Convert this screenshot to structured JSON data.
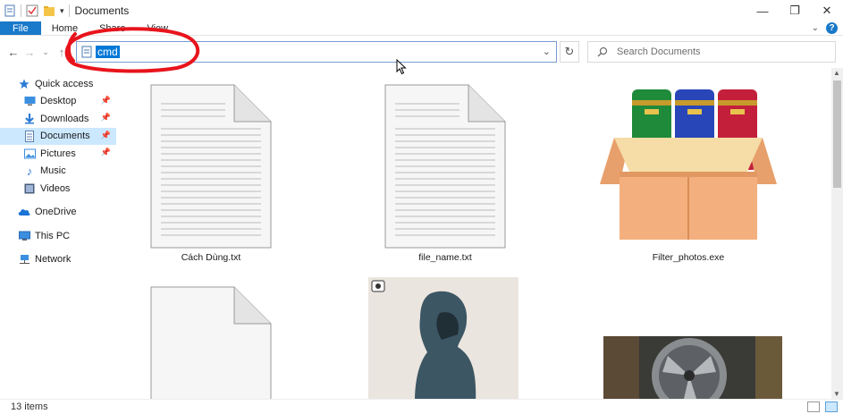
{
  "window": {
    "title": "Documents"
  },
  "ribbon": {
    "tabs": [
      {
        "label": "File"
      },
      {
        "label": "Home"
      },
      {
        "label": "Share"
      },
      {
        "label": "View"
      }
    ]
  },
  "address": {
    "value": "cmd"
  },
  "search": {
    "placeholder": "Search Documents"
  },
  "sidebar": {
    "items": [
      {
        "label": "Quick access",
        "icon": "star-icon"
      },
      {
        "label": "Desktop",
        "icon": "desktop-icon",
        "pinned": true
      },
      {
        "label": "Downloads",
        "icon": "download-icon",
        "pinned": true
      },
      {
        "label": "Documents",
        "icon": "documents-icon",
        "pinned": true,
        "selected": true
      },
      {
        "label": "Pictures",
        "icon": "pictures-icon",
        "pinned": true
      },
      {
        "label": "Music",
        "icon": "music-icon"
      },
      {
        "label": "Videos",
        "icon": "videos-icon"
      },
      {
        "label": "OneDrive",
        "icon": "cloud-icon"
      },
      {
        "label": "This PC",
        "icon": "computer-icon"
      },
      {
        "label": "Network",
        "icon": "network-icon"
      }
    ]
  },
  "files": [
    {
      "name": "Cách Dùng.txt",
      "type": "text"
    },
    {
      "name": "file_name.txt",
      "type": "text"
    },
    {
      "name": "Filter_photos.exe",
      "type": "installer"
    },
    {
      "name": "",
      "type": "blank"
    },
    {
      "name": "",
      "type": "image-portrait"
    },
    {
      "name": "",
      "type": "image-fan"
    }
  ],
  "status": {
    "count": "13 items"
  },
  "colors": {
    "accent": "#1979ca",
    "selection": "#cce8ff",
    "annotation": "#e8141c"
  }
}
